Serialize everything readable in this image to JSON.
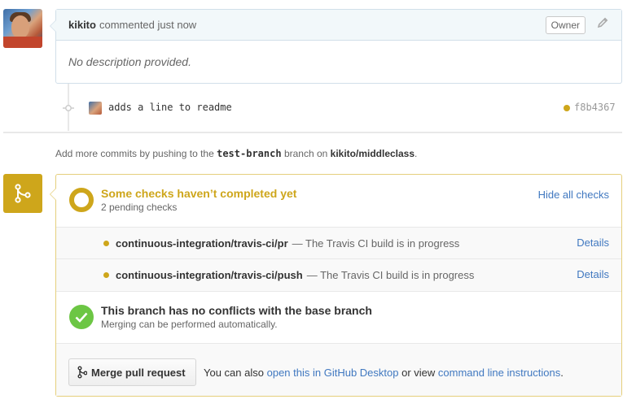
{
  "comment": {
    "author": "kikito",
    "action": "commented just now",
    "badge": "Owner",
    "body": "No description provided."
  },
  "commit": {
    "message": "adds a line to readme",
    "sha": "f8b4367",
    "status_color": "#cea61b"
  },
  "push_note": {
    "prefix": "Add more commits by pushing to the",
    "branch": "test-branch",
    "middle": "branch on",
    "repo": "kikito/middleclass",
    "suffix": "."
  },
  "status": {
    "title": "Some checks haven’t completed yet",
    "subtitle": "2 pending checks",
    "hide_label": "Hide all checks",
    "color": "#cea61b",
    "checks": [
      {
        "name": "continuous-integration/travis-ci/pr",
        "description": "— The Travis CI build is in progress",
        "details": "Details"
      },
      {
        "name": "continuous-integration/travis-ci/push",
        "description": "— The Travis CI build is in progress",
        "details": "Details"
      }
    ]
  },
  "conflict": {
    "title": "This branch has no conflicts with the base branch",
    "subtitle": "Merging can be performed automatically.",
    "color": "#6cc644"
  },
  "merge": {
    "button_label": "Merge pull request",
    "hint_prefix": "You can also",
    "desktop_link": "open this in GitHub Desktop",
    "hint_middle": "or view",
    "cli_link": "command line instructions",
    "hint_suffix": ".",
    "badge_color": "#cea61b"
  },
  "colors": {
    "link": "#4078c0",
    "pending": "#cea61b",
    "success": "#6cc644"
  },
  "icons": [
    "pencil-icon",
    "commit-icon",
    "git-merge-icon",
    "check-icon",
    "pending-circle-icon"
  ]
}
